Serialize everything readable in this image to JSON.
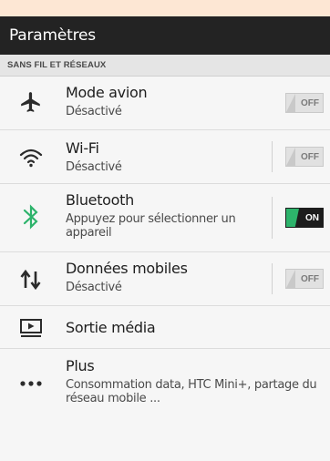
{
  "title": "Paramètres",
  "section": "SANS FIL ET RÉSEAUX",
  "colors": {
    "titlebar": "#232323",
    "background": "#f6f6f6",
    "accent": "#2db36b"
  },
  "rows": [
    {
      "icon": "airplane-icon",
      "title": "Mode avion",
      "subtitle": "Désactivé",
      "toggle": "OFF"
    },
    {
      "icon": "wifi-icon",
      "title": "Wi-Fi",
      "subtitle": "Désactivé",
      "toggle": "OFF"
    },
    {
      "icon": "bluetooth-icon",
      "title": "Bluetooth",
      "subtitle": "Appuyez pour sélectionner un appareil",
      "toggle": "ON"
    },
    {
      "icon": "mobile-data-icon",
      "title": "Données mobiles",
      "subtitle": "Désactivé",
      "toggle": "OFF"
    },
    {
      "icon": "media-output-icon",
      "title": "Sortie média"
    },
    {
      "icon": "more-icon",
      "title": "Plus",
      "subtitle": "Consommation data, HTC Mini+, partage du réseau mobile ..."
    }
  ]
}
